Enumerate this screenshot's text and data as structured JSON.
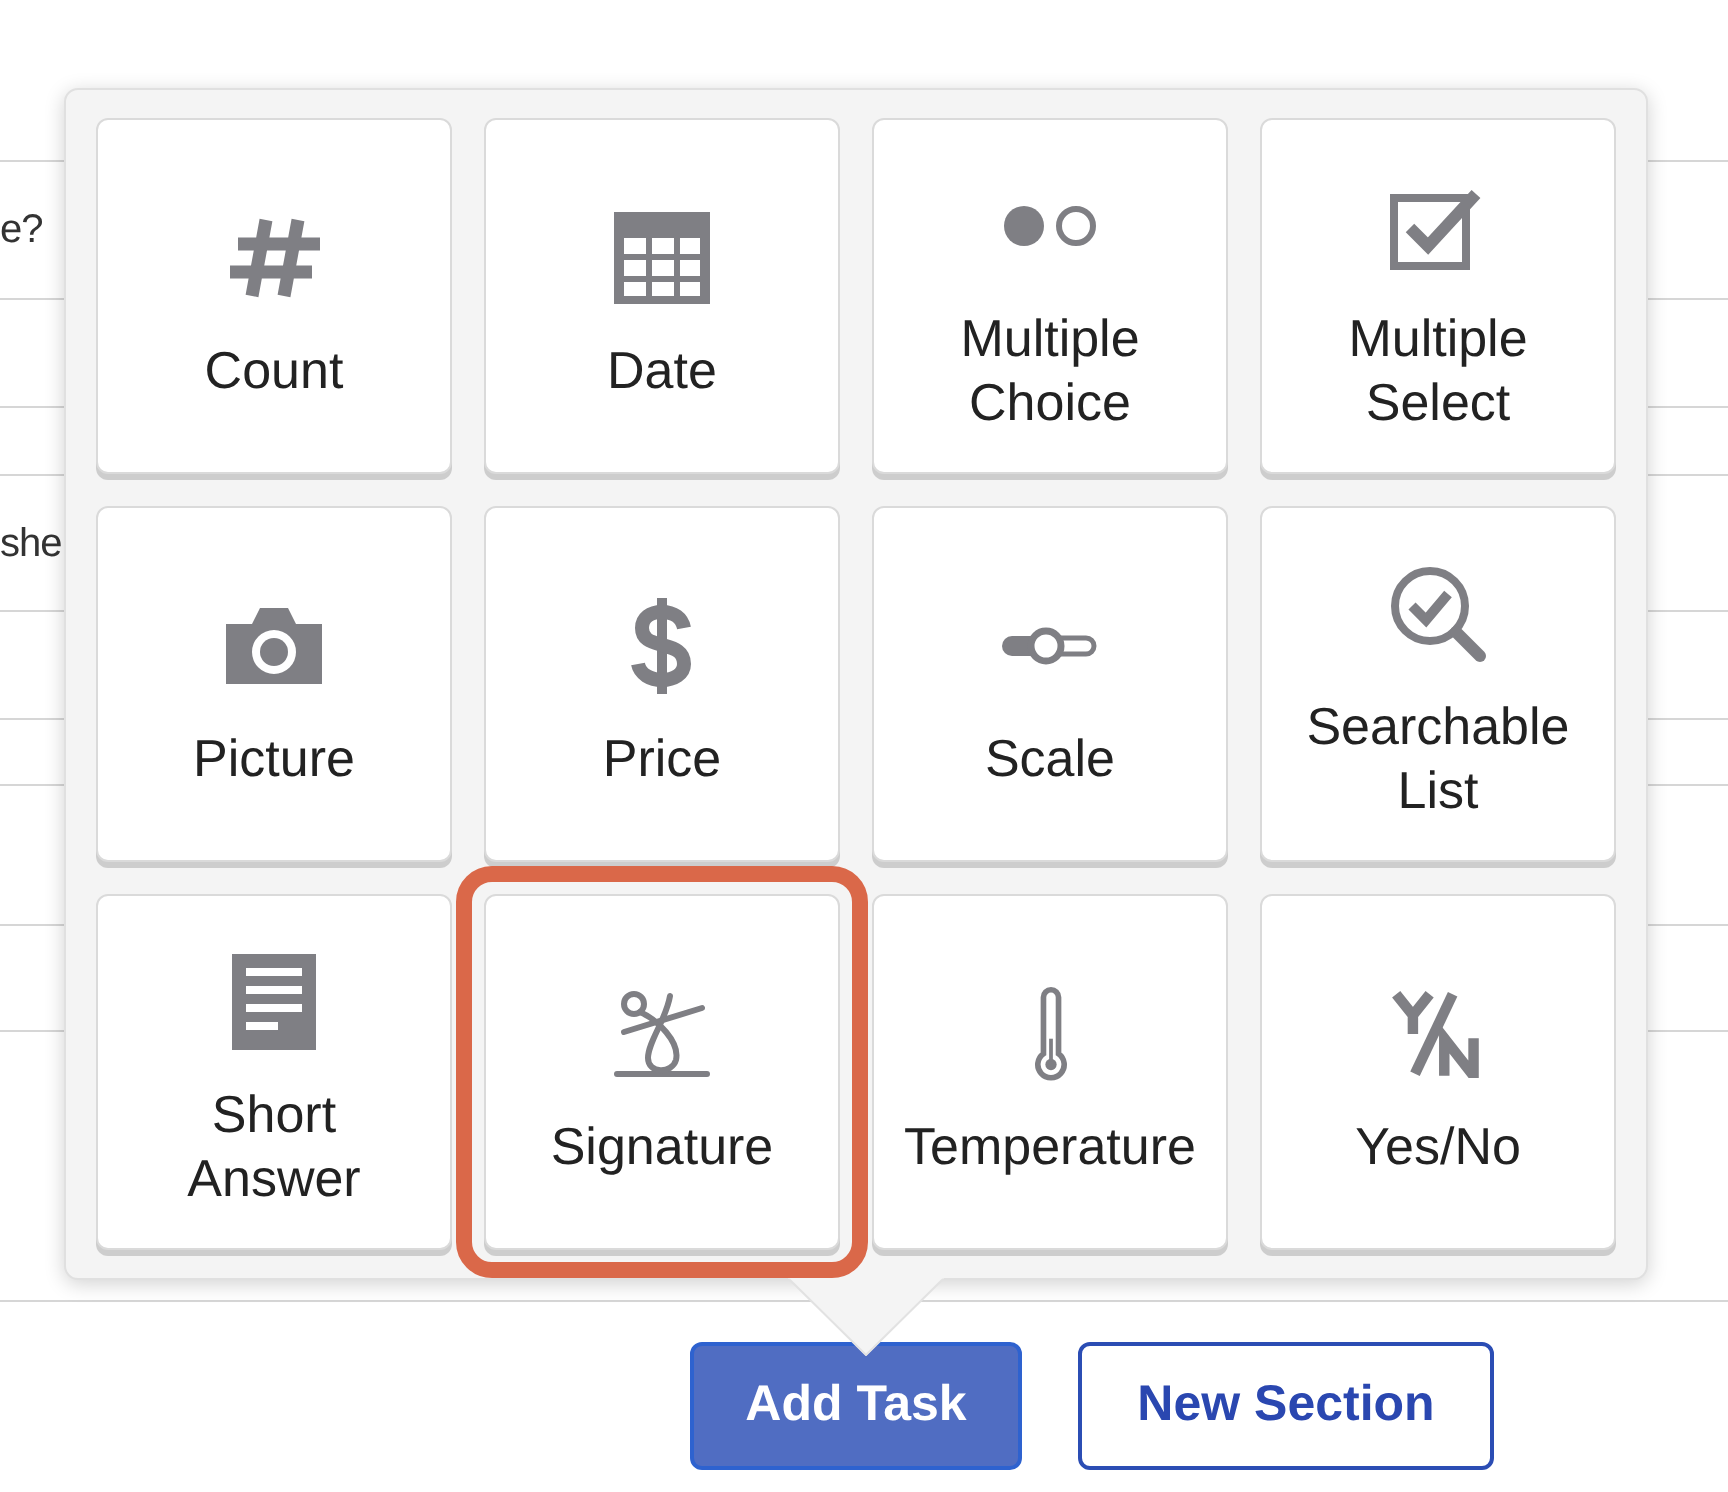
{
  "background": {
    "texts": [
      "e?",
      "she"
    ]
  },
  "task_types": [
    {
      "label": "Count",
      "kind": "count",
      "selected": false
    },
    {
      "label": "Date",
      "kind": "date",
      "selected": false
    },
    {
      "label": "Multiple Choice",
      "kind": "multiple_choice",
      "selected": false
    },
    {
      "label": "Multiple Select",
      "kind": "multiple_select",
      "selected": false
    },
    {
      "label": "Picture",
      "kind": "picture",
      "selected": false
    },
    {
      "label": "Price",
      "kind": "price",
      "selected": false
    },
    {
      "label": "Scale",
      "kind": "scale",
      "selected": false
    },
    {
      "label": "Searchable List",
      "kind": "searchable_list",
      "selected": false
    },
    {
      "label": "Short Answer",
      "kind": "short_answer",
      "selected": false
    },
    {
      "label": "Signature",
      "kind": "signature",
      "selected": true
    },
    {
      "label": "Temperature",
      "kind": "temperature",
      "selected": false
    },
    {
      "label": "Yes/No",
      "kind": "yes_no",
      "selected": false
    }
  ],
  "buttons": [
    {
      "label": "Add Task",
      "kind": "primary"
    },
    {
      "label": "New Section",
      "kind": "secondary"
    }
  ]
}
